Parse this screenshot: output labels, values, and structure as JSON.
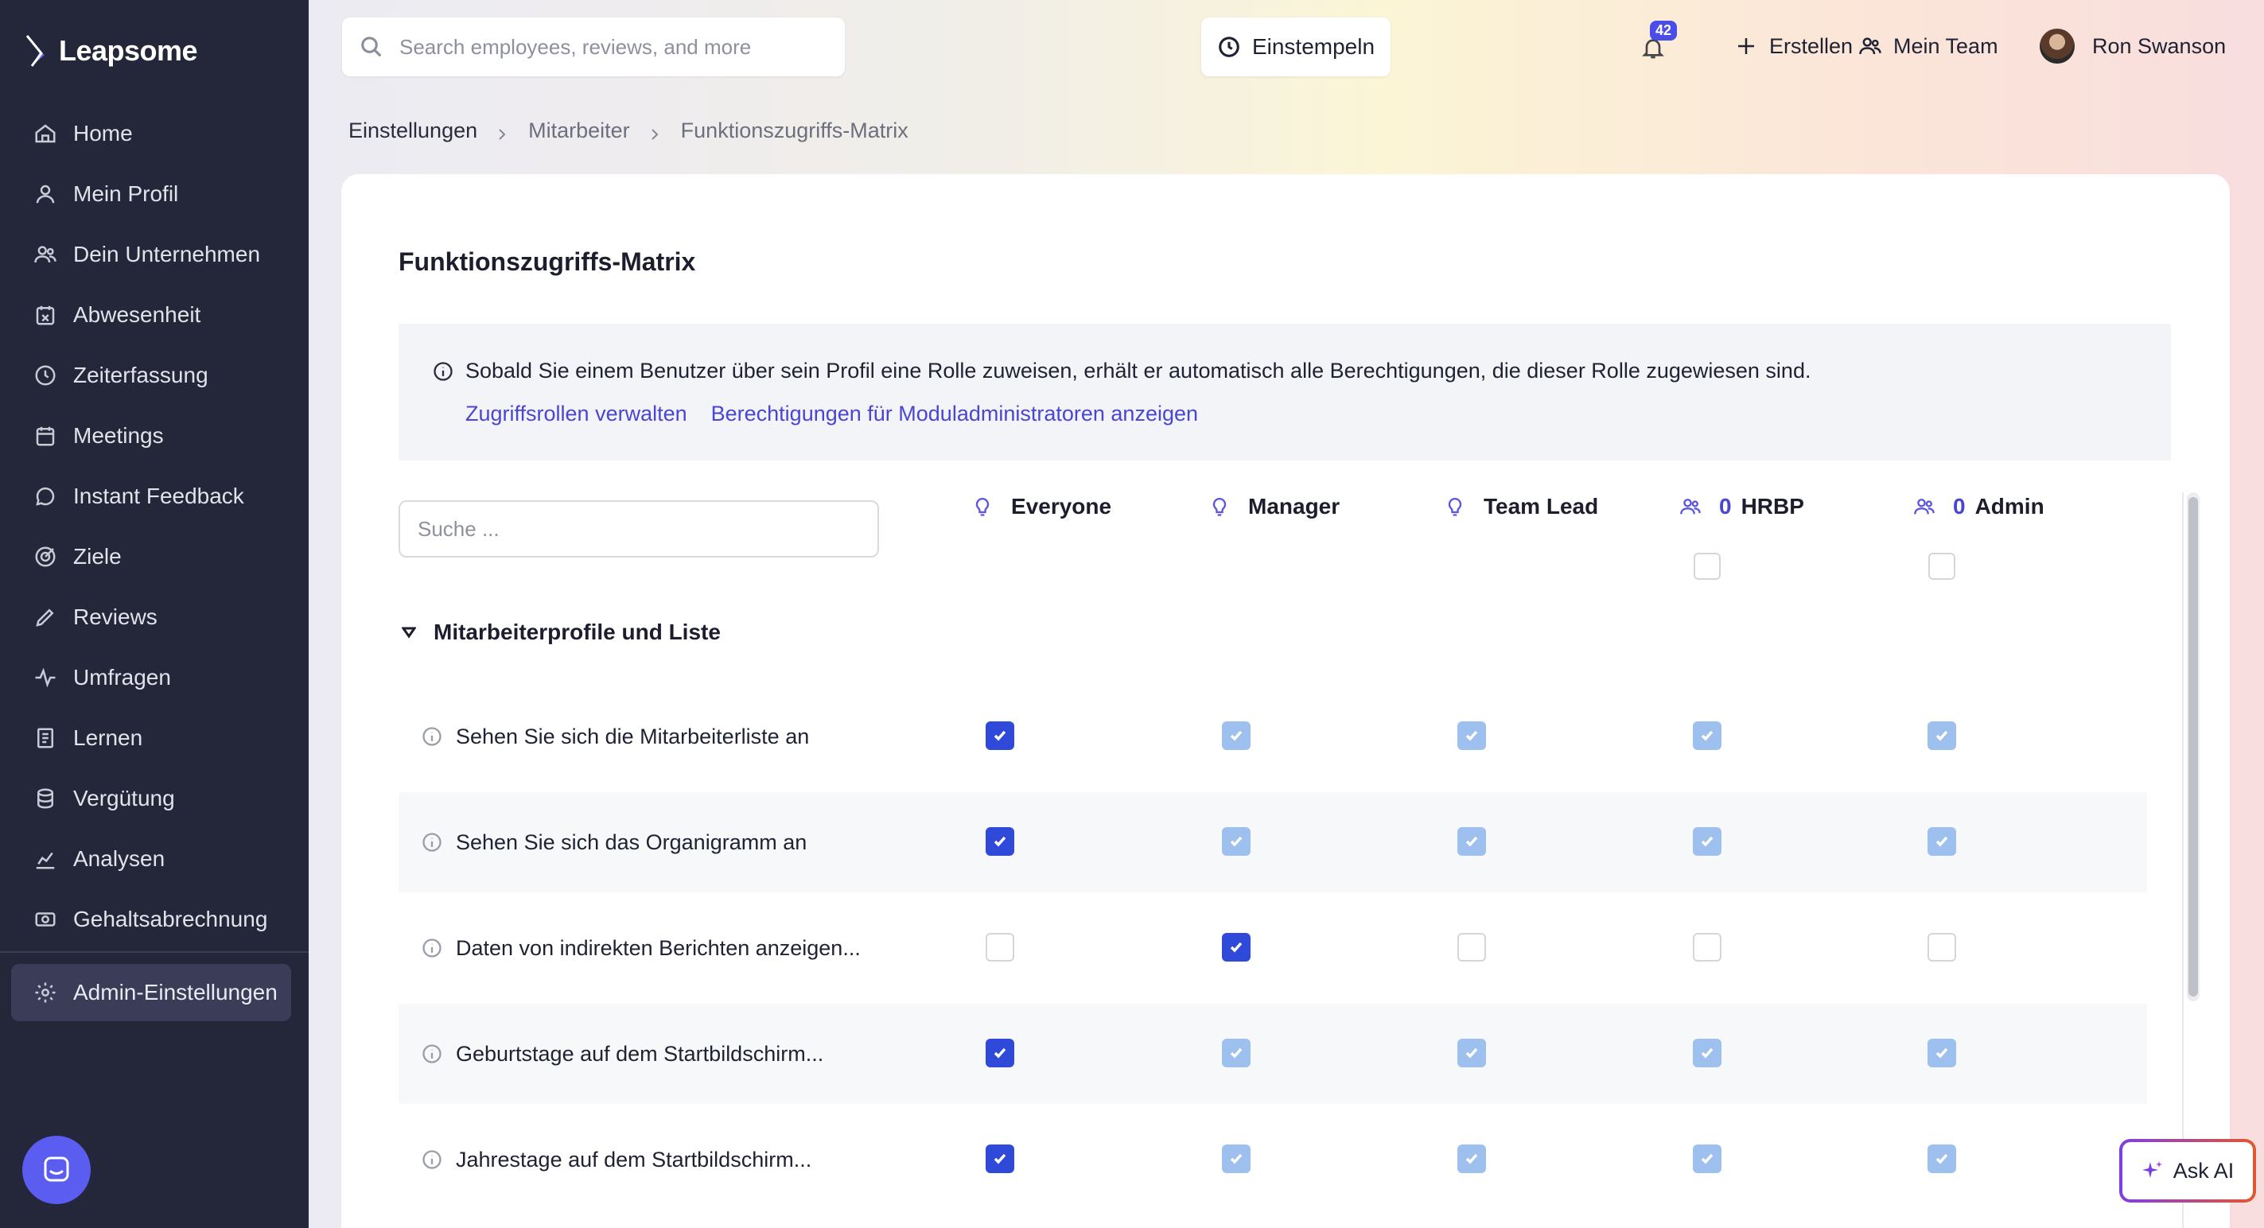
{
  "app": {
    "brand": "Leapsome"
  },
  "sidebar": {
    "items": [
      {
        "label": "Home",
        "icon": "home-icon"
      },
      {
        "label": "Mein Profil",
        "icon": "user-icon"
      },
      {
        "label": "Dein Unternehmen",
        "icon": "users-icon"
      },
      {
        "label": "Abwesenheit",
        "icon": "calendar-x-icon"
      },
      {
        "label": "Zeiterfassung",
        "icon": "clock-icon"
      },
      {
        "label": "Meetings",
        "icon": "calendar-icon"
      },
      {
        "label": "Instant Feedback",
        "icon": "chat-icon"
      },
      {
        "label": "Ziele",
        "icon": "target-icon"
      },
      {
        "label": "Reviews",
        "icon": "pencil-icon"
      },
      {
        "label": "Umfragen",
        "icon": "pulse-icon"
      },
      {
        "label": "Lernen",
        "icon": "book-icon"
      },
      {
        "label": "Vergütung",
        "icon": "coins-icon"
      },
      {
        "label": "Analysen",
        "icon": "chart-icon"
      },
      {
        "label": "Gehaltsabrechnung",
        "icon": "money-icon"
      }
    ],
    "admin": {
      "label": "Admin-Einstellungen",
      "icon": "gear-icon"
    }
  },
  "topbar": {
    "search_placeholder": "Search employees, reviews, and more",
    "clockin_label": "Einstempeln",
    "notifications_count": "42",
    "create_label": "Erstellen",
    "team_label": "Mein Team",
    "user_name": "Ron Swanson"
  },
  "breadcrumb": [
    "Einstellungen",
    "Mitarbeiter",
    "Funktionszugriffs-Matrix"
  ],
  "page": {
    "title": "Funktionszugriffs-Matrix",
    "info_text": "Sobald Sie einem Benutzer über sein Profil eine Rolle zuweisen, erhält er automatisch alle Berechtigungen, die dieser Rolle zugewiesen sind.",
    "link_roles": "Zugriffsrollen verwalten",
    "link_module_admins": "Berechtigungen für Moduladministratoren anzeigen",
    "search_placeholder": "Suche ..."
  },
  "matrix": {
    "columns": [
      {
        "name": "Everyone",
        "icon": "bulb-icon",
        "count": ""
      },
      {
        "name": "Manager",
        "icon": "bulb-icon",
        "count": ""
      },
      {
        "name": "Team Lead",
        "icon": "bulb-icon",
        "count": ""
      },
      {
        "name": "HRBP",
        "icon": "users-icon",
        "count": "0"
      },
      {
        "name": "Admin",
        "icon": "users-icon",
        "count": "0"
      }
    ],
    "group": "Mitarbeiterprofile und Liste",
    "rows": [
      {
        "label": "Sehen Sie sich die Mitarbeiterliste an",
        "states": [
          "on",
          "inherited",
          "inherited",
          "inherited",
          "inherited"
        ]
      },
      {
        "label": "Sehen Sie sich das Organigramm an",
        "states": [
          "on",
          "inherited",
          "inherited",
          "inherited",
          "inherited"
        ]
      },
      {
        "label": "Daten von indirekten Berichten anzeigen...",
        "states": [
          "off",
          "on",
          "off",
          "off",
          "off"
        ]
      },
      {
        "label": "Geburtstage auf dem Startbildschirm...",
        "states": [
          "on",
          "inherited",
          "inherited",
          "inherited",
          "inherited"
        ]
      },
      {
        "label": "Jahrestage auf dem Startbildschirm...",
        "states": [
          "on",
          "inherited",
          "inherited",
          "inherited",
          "inherited"
        ]
      }
    ]
  },
  "ask_ai_label": "Ask AI",
  "colors": {
    "sidebar": "#24263a",
    "accent": "#4a45d4",
    "checked": "#2f49d8",
    "inherited": "#9ec0ee"
  }
}
